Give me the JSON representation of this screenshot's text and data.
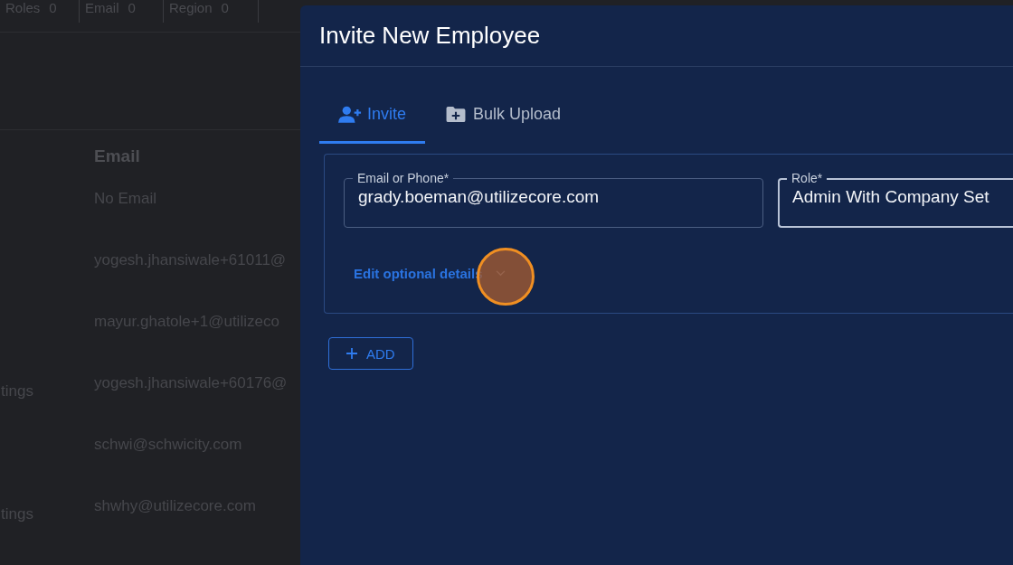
{
  "background_page": {
    "filter_chips": [
      {
        "label": "Roles",
        "count": "0"
      },
      {
        "label": "Email",
        "count": "0"
      },
      {
        "label": "Region",
        "count": "0"
      }
    ],
    "table": {
      "column_header": "Email",
      "rows": [
        {
          "email": "No Email"
        },
        {
          "email": "yogesh.jhansiwale+61011@"
        },
        {
          "email": "mayur.ghatole+1@utilizeco"
        },
        {
          "column_1": "tings",
          "email": "yogesh.jhansiwale+60176@"
        },
        {
          "email": "schwi@schwicity.com"
        },
        {
          "column_1": "tings",
          "email": "shwhy@utilizecore.com"
        }
      ]
    }
  },
  "dialog": {
    "title": "Invite New Employee",
    "tabs": [
      {
        "label": "Invite",
        "kind": "person-add",
        "selected": true
      },
      {
        "label": "Bulk Upload",
        "kind": "folder-add",
        "selected": false
      }
    ],
    "fields": [
      {
        "label": "Email or Phone*",
        "value": "grady.boeman@utilizecore.com",
        "focused": false
      },
      {
        "label": "Role*",
        "value": "Admin With Company Set",
        "focused": true
      }
    ],
    "optional_details": {
      "label": "Edit optional details",
      "expanded": false
    },
    "add_button": {
      "label": "ADD"
    }
  }
}
